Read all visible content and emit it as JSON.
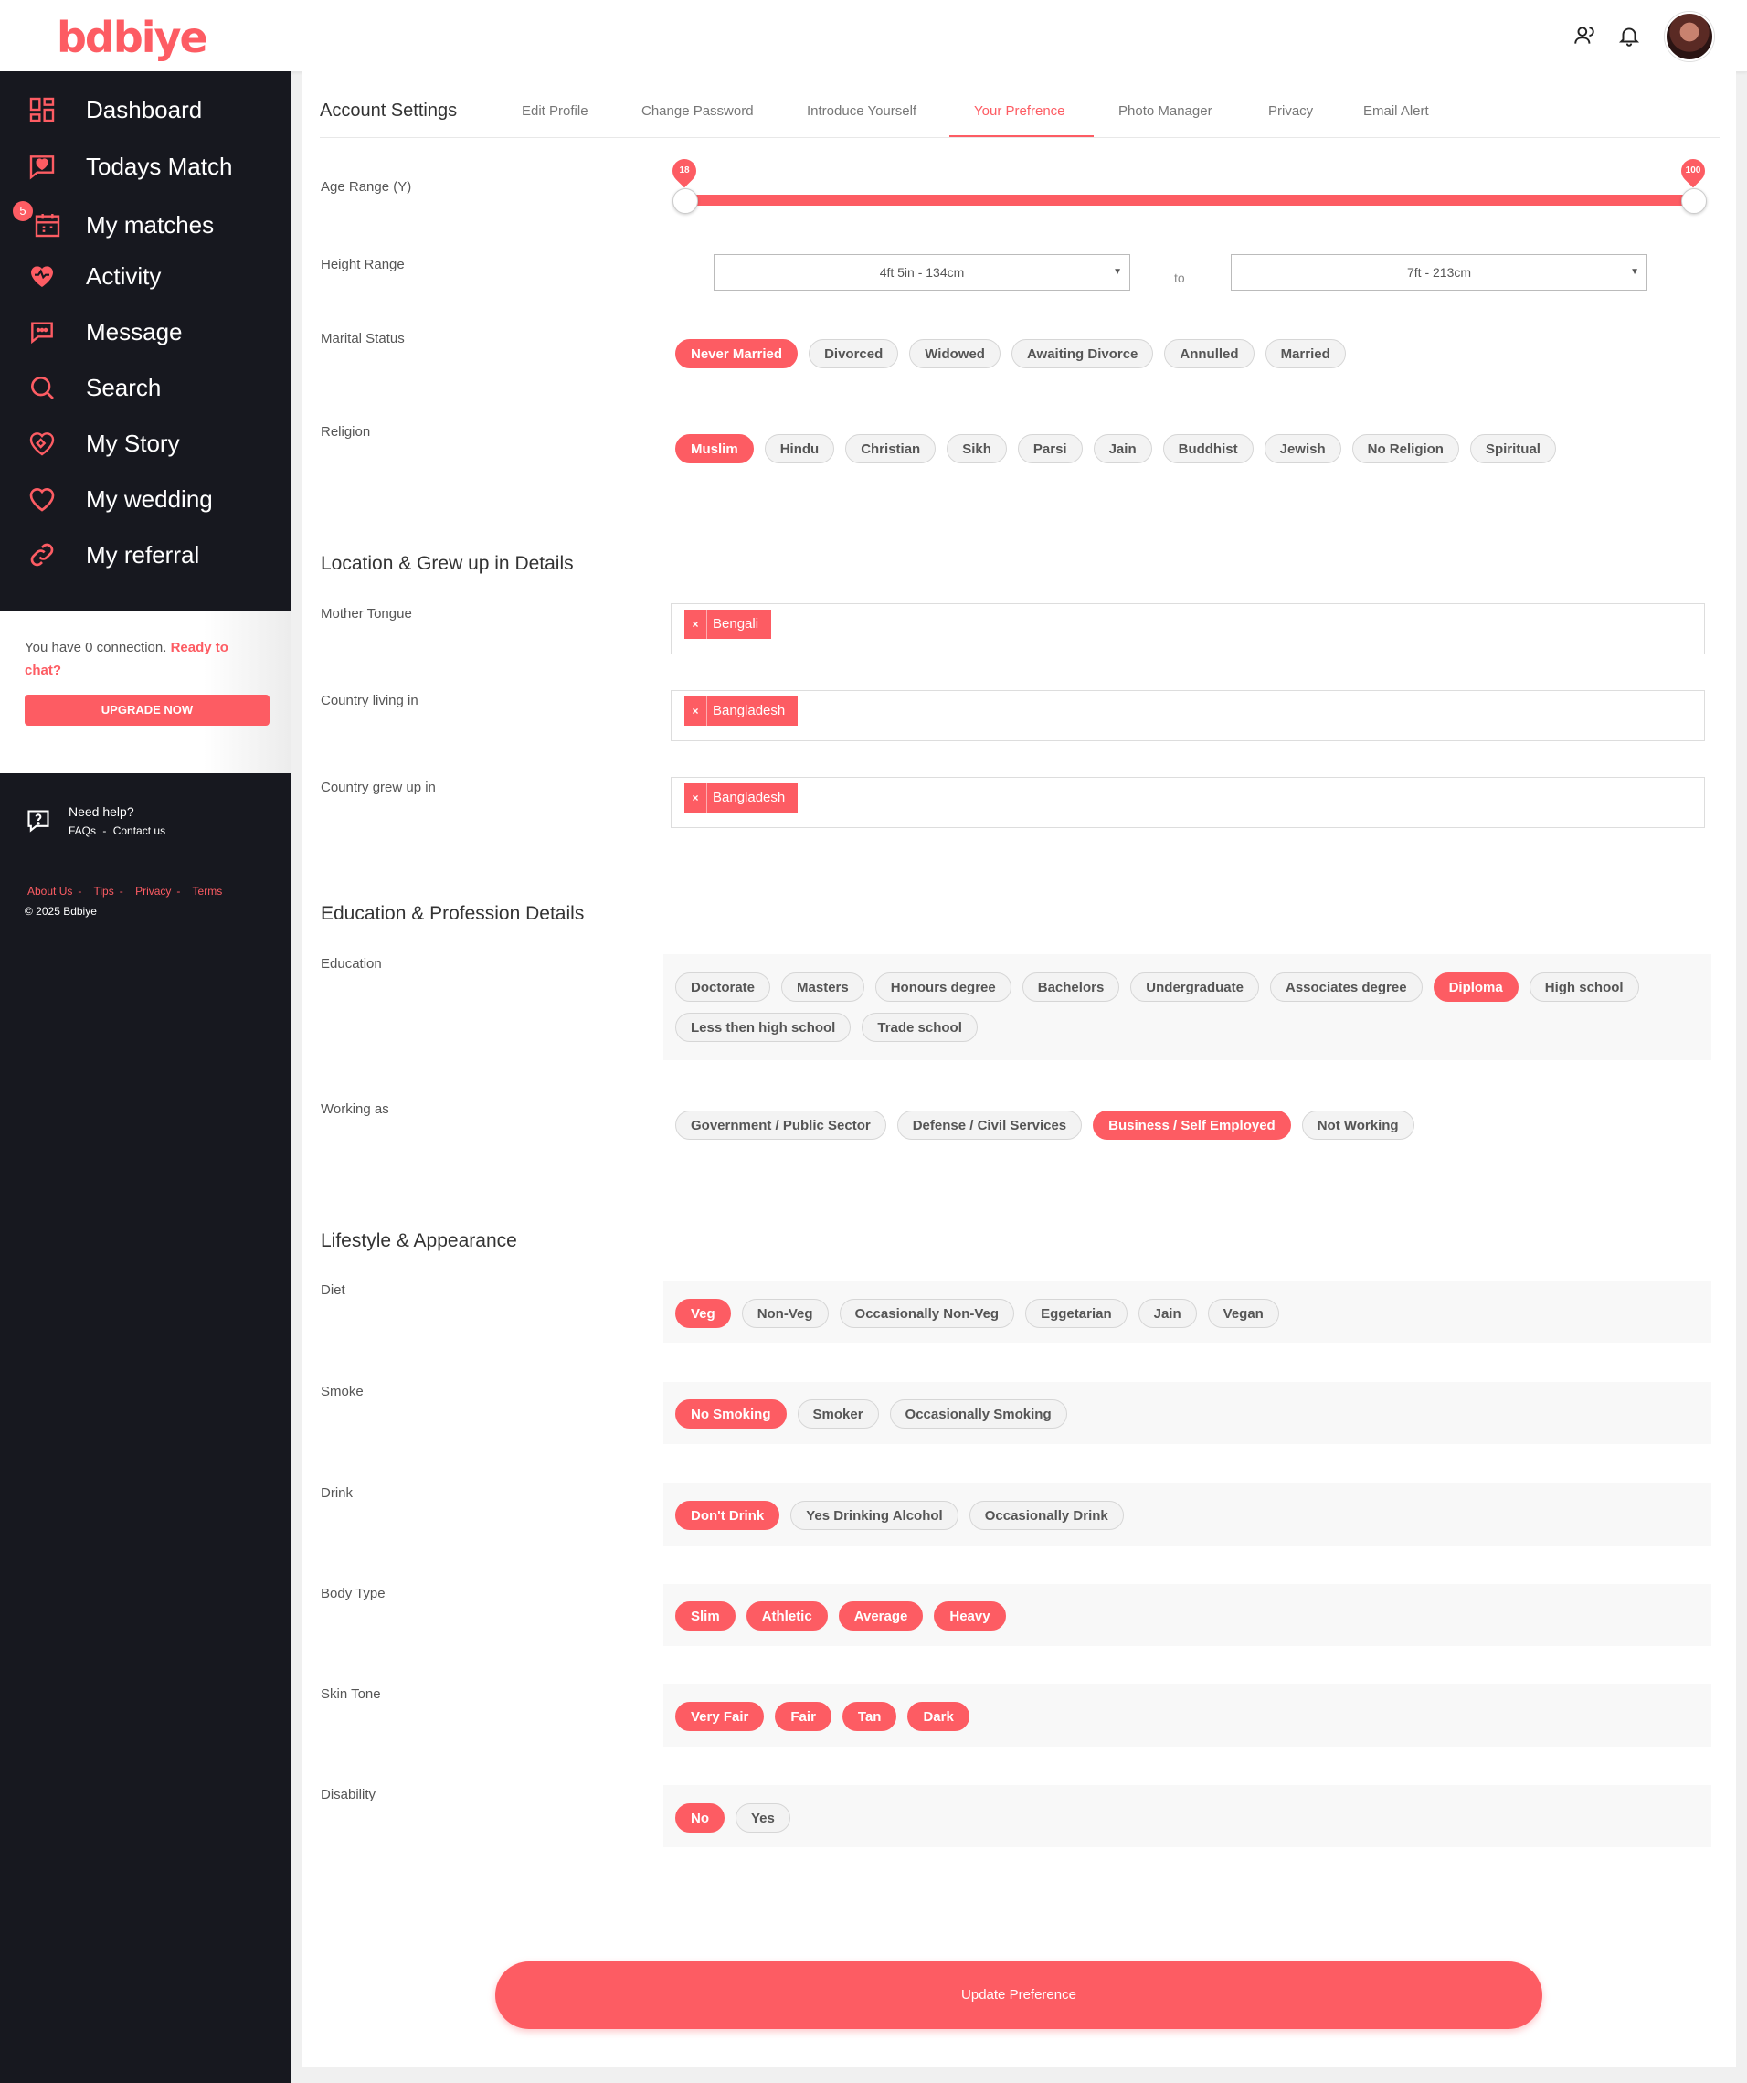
{
  "brand": {
    "logo_text": "bdbiye",
    "accent": "#fd5c63"
  },
  "header": {
    "icons": [
      "users-icon",
      "bell-icon"
    ],
    "avatar": "user-avatar"
  },
  "sidebar": {
    "items": [
      {
        "label": "Dashboard",
        "icon": "dashboard-icon"
      },
      {
        "label": "Todays Match",
        "icon": "heart-chat-icon"
      },
      {
        "label": "My matches",
        "icon": "calendar-icon",
        "badge": "5"
      },
      {
        "label": "Activity",
        "icon": "activity-icon"
      },
      {
        "label": "Message",
        "icon": "message-icon"
      },
      {
        "label": "Search",
        "icon": "search-icon"
      },
      {
        "label": "My Story",
        "icon": "story-icon"
      },
      {
        "label": "My wedding",
        "icon": "heart-icon"
      },
      {
        "label": "My referral",
        "icon": "link-icon"
      }
    ],
    "promo": {
      "text": "You have 0 connection.",
      "highlight": "Ready to chat?",
      "button": "UPGRADE NOW"
    },
    "help": {
      "title": "Need help?",
      "faqs": "FAQs",
      "separator": "-",
      "contact": "Contact us"
    },
    "footer": {
      "links": [
        "About Us",
        "Tips",
        "Privacy",
        "Terms"
      ],
      "copyright": "© 2025 Bdbiye"
    }
  },
  "tabs": {
    "title": "Account Settings",
    "items": [
      "Edit Profile",
      "Change Password",
      "Introduce Yourself",
      "Your Prefrence",
      "Photo Manager",
      "Privacy",
      "Email Alert"
    ],
    "active": "Your Prefrence"
  },
  "age_range": {
    "label": "Age Range (Y)",
    "min": "18",
    "max": "100"
  },
  "height_range": {
    "label": "Height Range",
    "from": "4ft 5in - 134cm",
    "to_label": "to",
    "to": "7ft - 213cm"
  },
  "marital_status": {
    "label": "Marital Status",
    "options": [
      "Never Married",
      "Divorced",
      "Widowed",
      "Awaiting Divorce",
      "Annulled",
      "Married"
    ],
    "selected": [
      "Never Married"
    ]
  },
  "religion": {
    "label": "Religion",
    "options": [
      "Muslim",
      "Hindu",
      "Christian",
      "Sikh",
      "Parsi",
      "Jain",
      "Buddhist",
      "Jewish",
      "No Religion",
      "Spiritual"
    ],
    "selected": [
      "Muslim"
    ]
  },
  "location": {
    "title": "Location & Grew up in Details",
    "mother_tongue": {
      "label": "Mother Tongue",
      "tag": "Bengali"
    },
    "country_living": {
      "label": "Country living in",
      "tag": "Bangladesh"
    },
    "country_grew": {
      "label": "Country grew up in",
      "tag": "Bangladesh"
    }
  },
  "education_section": {
    "title": "Education & Profession Details",
    "education": {
      "label": "Education",
      "options": [
        "Doctorate",
        "Masters",
        "Honours degree",
        "Bachelors",
        "Undergraduate",
        "Associates degree",
        "Diploma",
        "High school",
        "Less then high school",
        "Trade school"
      ],
      "selected": [
        "Diploma"
      ]
    },
    "working": {
      "label": "Working as",
      "options": [
        "Government / Public Sector",
        "Defense / Civil Services",
        "Business / Self Employed",
        "Not Working"
      ],
      "selected": [
        "Business / Self Employed"
      ]
    }
  },
  "lifestyle": {
    "title": "Lifestyle & Appearance",
    "diet": {
      "label": "Diet",
      "options": [
        "Veg",
        "Non-Veg",
        "Occasionally Non-Veg",
        "Eggetarian",
        "Jain",
        "Vegan"
      ],
      "selected": [
        "Veg"
      ]
    },
    "smoke": {
      "label": "Smoke",
      "options": [
        "No Smoking",
        "Smoker",
        "Occasionally Smoking"
      ],
      "selected": [
        "No Smoking"
      ]
    },
    "drink": {
      "label": "Drink",
      "options": [
        "Don't Drink",
        "Yes Drinking Alcohol",
        "Occasionally Drink"
      ],
      "selected": [
        "Don't Drink"
      ]
    },
    "body": {
      "label": "Body Type",
      "options": [
        "Slim",
        "Athletic",
        "Average",
        "Heavy"
      ],
      "selected": [
        "Slim",
        "Athletic",
        "Average",
        "Heavy"
      ]
    },
    "skin": {
      "label": "Skin Tone",
      "options": [
        "Very Fair",
        "Fair",
        "Tan",
        "Dark"
      ],
      "selected": [
        "Very Fair",
        "Fair",
        "Tan",
        "Dark"
      ]
    },
    "disability": {
      "label": "Disability",
      "options": [
        "No",
        "Yes"
      ],
      "selected": [
        "No"
      ]
    }
  },
  "submit": {
    "label": "Update Preference"
  }
}
